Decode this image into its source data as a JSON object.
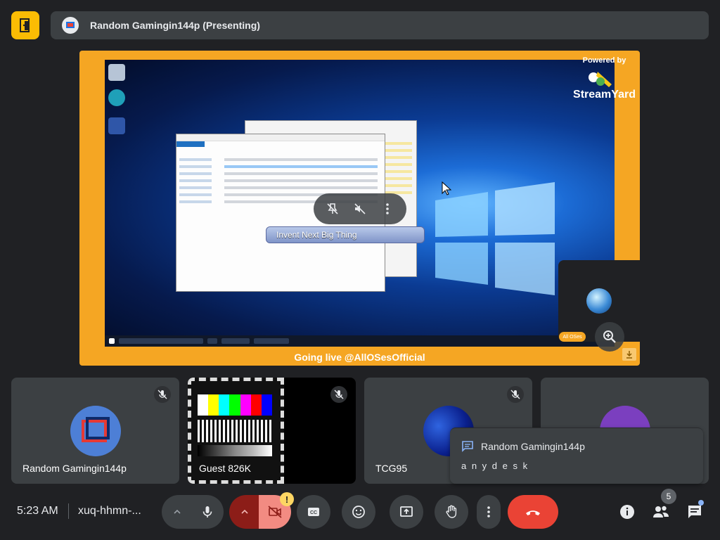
{
  "header": {
    "presenter_title": "Random Gamingin144p (Presenting)",
    "logo_icon": "door-exit-icon",
    "presenting_icon": "present-screen-icon"
  },
  "presentation": {
    "powered_by": "Powered by",
    "brand": "StreamYard",
    "banner_text": "Going live @AllOSesOfficial",
    "overlay_label": "Invent Next Big Thing",
    "camera_badge": "All OSes",
    "colors": {
      "frame": "#f5a623",
      "wallpaper": "#0b3b93"
    }
  },
  "tiles": [
    {
      "name": "Random Gamingin144p",
      "muted": true,
      "avatar": "pixel-square-avatar",
      "avatar_color": "#4d7fd6"
    },
    {
      "name": "Guest 826K",
      "muted": true,
      "video": "test-card"
    },
    {
      "name": "TCG95",
      "muted": true,
      "avatar_color": "#0a1f8c"
    },
    {
      "name": "",
      "muted": false,
      "avatar_color": "#7b3fbf"
    }
  ],
  "chat_popup": {
    "sender": "Random Gamingin144p",
    "message": "a n y d e s k"
  },
  "meeting": {
    "time": "5:23 AM",
    "code": "xuq-hhmn-..."
  },
  "controls": {
    "participants_count": "5",
    "warning_badge": "!",
    "end_call_color": "#ea4335",
    "accent_color": "#8ab4f8"
  }
}
